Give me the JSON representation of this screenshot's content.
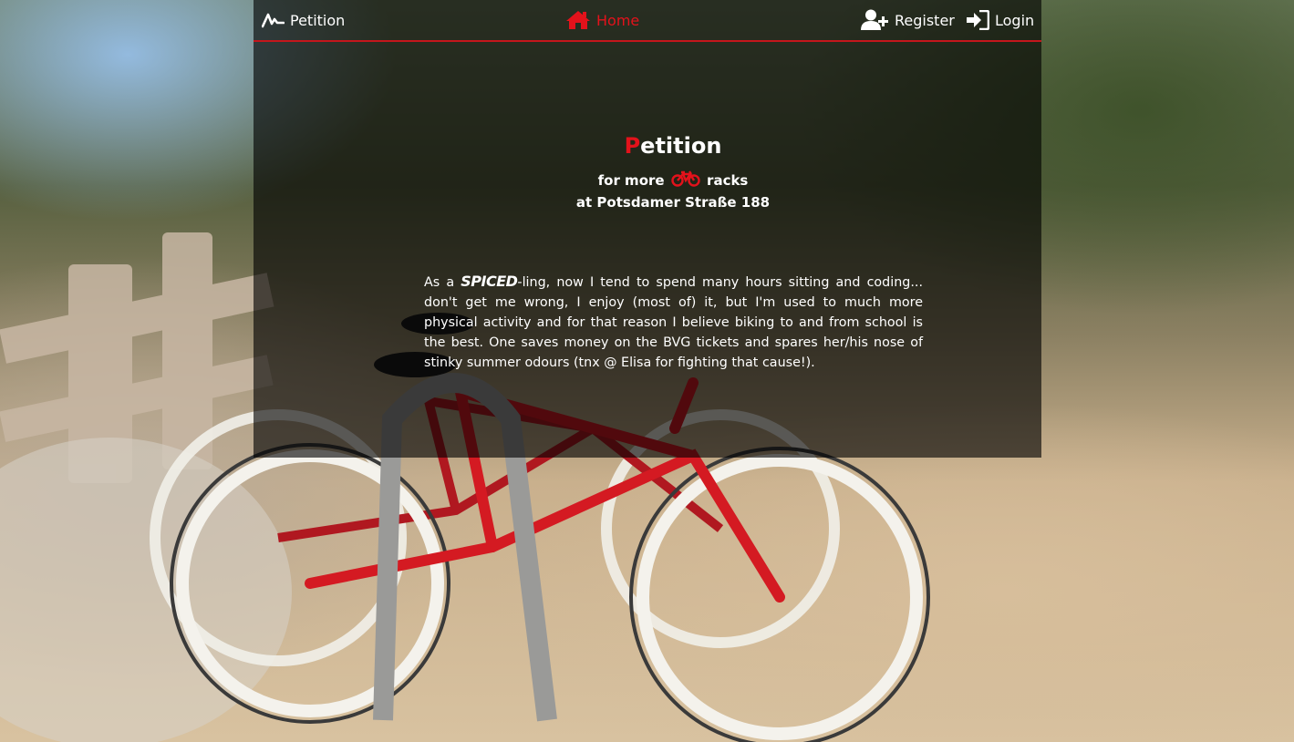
{
  "nav": {
    "brand_label": "Petition",
    "brand_icon": "pulse-icon",
    "home_label": "Home",
    "home_icon": "home-icon",
    "register_label": "Register",
    "register_icon": "user-plus-icon",
    "login_label": "Login",
    "login_icon": "sign-in-icon"
  },
  "hero": {
    "title_first_letter": "P",
    "title_rest": "etition",
    "subtitle_before_icon": "for more",
    "subtitle_after_icon": "racks",
    "subtitle_icon": "bicycle-icon",
    "subtitle_line2": "at Potsdamer Straße 188"
  },
  "intro": {
    "before_brand": "As a ",
    "brand": "SPICED",
    "after_brand": "-ling, now I tend to spend many hours sitting and coding... don't get me wrong, I enjoy (most of) it, but I'm used to much more physical activity and for that reason I believe biking to and from school is the best. One saves money on the BVG tickets and spares her/his nose of stinky summer odours (tnx @ Elisa for fighting that cause!)."
  },
  "colors": {
    "accent": "#e3121b",
    "nav_border": "#c4161c",
    "text": "#ffffff",
    "panel_overlay": "rgba(0,0,0,0.62)"
  }
}
